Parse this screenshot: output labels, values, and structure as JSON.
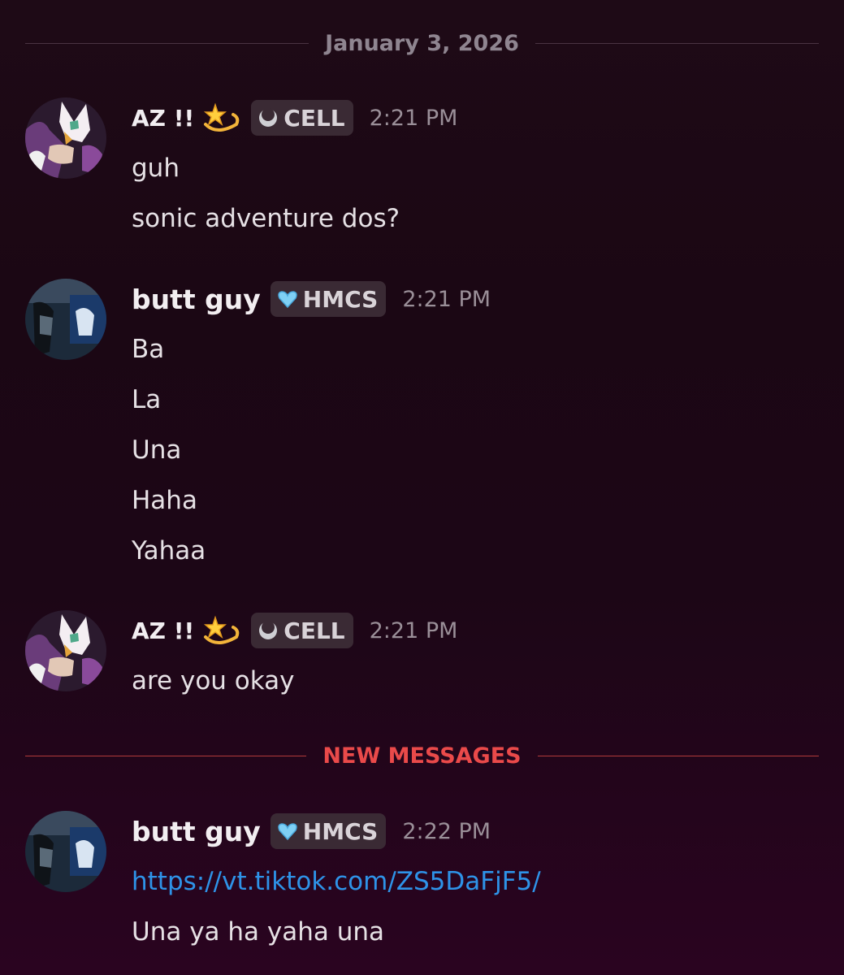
{
  "date_divider": "January 3, 2026",
  "new_divider": "NEW MESSAGES",
  "messages": [
    {
      "username": "AZ !!",
      "tag": "CELL",
      "time": "2:21 PM",
      "lines": [
        "guh",
        "sonic adventure dos?"
      ]
    },
    {
      "username": "butt guy",
      "tag": "HMCS",
      "time": "2:21 PM",
      "lines": [
        "Ba",
        "La",
        "Una",
        "Haha",
        "Yahaa"
      ]
    },
    {
      "username": "AZ !!",
      "tag": "CELL",
      "time": "2:21 PM",
      "lines": [
        "are you okay"
      ]
    },
    {
      "username": "butt guy",
      "tag": "HMCS",
      "time": "2:22 PM",
      "link": "https://vt.tiktok.com/ZS5DaFjF5/",
      "lines": [
        "Una ya ha yaha una"
      ]
    }
  ],
  "icons": {
    "az_emoji": "dizzy-star-icon",
    "cell_tag": "moon-icon",
    "hmcs_tag": "heart-icon"
  },
  "colors": {
    "new_messages": "#ea4a4a",
    "link": "#2e93e8"
  }
}
